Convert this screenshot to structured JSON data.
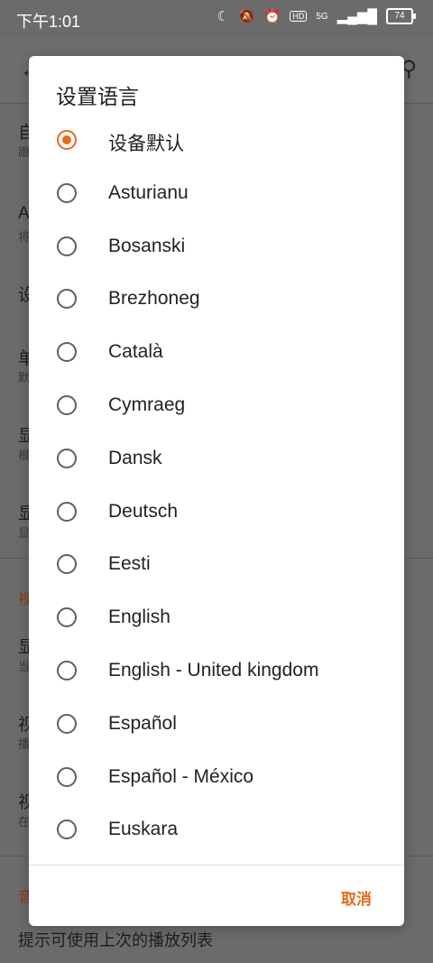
{
  "status_bar": {
    "time": "下午1:01",
    "network": "5G",
    "battery": "74"
  },
  "background": {
    "rows": [
      {
        "title": "自",
        "subtitle": "跟"
      },
      {
        "title": "A",
        "subtitle": "将"
      },
      {
        "title": "设",
        "subtitle": ""
      },
      {
        "title": "单",
        "subtitle": "默"
      },
      {
        "title": "显",
        "subtitle": "根"
      },
      {
        "title": "显",
        "subtitle": "显"
      }
    ],
    "section_video": "视",
    "rows2": [
      {
        "title": "显",
        "subtitle": "当"
      },
      {
        "title": "视",
        "subtitle": "播"
      },
      {
        "title": "视",
        "subtitle": "在"
      }
    ],
    "section_audio": "音",
    "bottom_text": "提示可使用上次的播放列表"
  },
  "dialog": {
    "title": "设置语言",
    "options": [
      {
        "label": "设备默认",
        "selected": true
      },
      {
        "label": "Asturianu",
        "selected": false
      },
      {
        "label": "Bosanski",
        "selected": false
      },
      {
        "label": "Brezhoneg",
        "selected": false
      },
      {
        "label": "Català",
        "selected": false
      },
      {
        "label": "Cymraeg",
        "selected": false
      },
      {
        "label": "Dansk",
        "selected": false
      },
      {
        "label": "Deutsch",
        "selected": false
      },
      {
        "label": "Eesti",
        "selected": false
      },
      {
        "label": "English",
        "selected": false
      },
      {
        "label": "English - United kingdom",
        "selected": false
      },
      {
        "label": "Español",
        "selected": false
      },
      {
        "label": "Español - México",
        "selected": false
      },
      {
        "label": "Euskara",
        "selected": false
      }
    ],
    "cancel_label": "取消"
  },
  "colors": {
    "accent": "#e8691d",
    "scrim": "#6b6b6b"
  }
}
